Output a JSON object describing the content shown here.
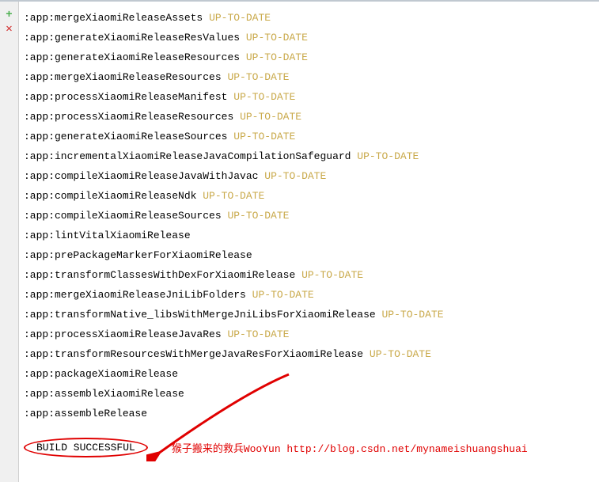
{
  "gutter": {
    "add": "+",
    "remove": "✕"
  },
  "lines": [
    {
      "task": ":app:mergeXiaomiReleaseAssets",
      "status": "UP-TO-DATE"
    },
    {
      "task": ":app:generateXiaomiReleaseResValues",
      "status": "UP-TO-DATE"
    },
    {
      "task": ":app:generateXiaomiReleaseResources",
      "status": "UP-TO-DATE"
    },
    {
      "task": ":app:mergeXiaomiReleaseResources",
      "status": "UP-TO-DATE"
    },
    {
      "task": ":app:processXiaomiReleaseManifest",
      "status": "UP-TO-DATE"
    },
    {
      "task": ":app:processXiaomiReleaseResources",
      "status": "UP-TO-DATE"
    },
    {
      "task": ":app:generateXiaomiReleaseSources",
      "status": "UP-TO-DATE"
    },
    {
      "task": ":app:incrementalXiaomiReleaseJavaCompilationSafeguard",
      "status": "UP-TO-DATE"
    },
    {
      "task": ":app:compileXiaomiReleaseJavaWithJavac",
      "status": "UP-TO-DATE"
    },
    {
      "task": ":app:compileXiaomiReleaseNdk",
      "status": "UP-TO-DATE"
    },
    {
      "task": ":app:compileXiaomiReleaseSources",
      "status": "UP-TO-DATE"
    },
    {
      "task": ":app:lintVitalXiaomiRelease",
      "status": ""
    },
    {
      "task": ":app:prePackageMarkerForXiaomiRelease",
      "status": ""
    },
    {
      "task": ":app:transformClassesWithDexForXiaomiRelease",
      "status": "UP-TO-DATE"
    },
    {
      "task": ":app:mergeXiaomiReleaseJniLibFolders",
      "status": "UP-TO-DATE"
    },
    {
      "task": ":app:transformNative_libsWithMergeJniLibsForXiaomiRelease",
      "status": "UP-TO-DATE"
    },
    {
      "task": ":app:processXiaomiReleaseJavaRes",
      "status": "UP-TO-DATE"
    },
    {
      "task": ":app:transformResourcesWithMergeJavaResForXiaomiRelease",
      "status": "UP-TO-DATE"
    },
    {
      "task": ":app:packageXiaomiRelease",
      "status": ""
    },
    {
      "task": ":app:assembleXiaomiRelease",
      "status": ""
    },
    {
      "task": ":app:assembleRelease",
      "status": ""
    }
  ],
  "build_result": "BUILD SUCCESSFUL",
  "watermark": "猴子搬来的救兵WooYun http://blog.csdn.net/mynameishuangshuai"
}
